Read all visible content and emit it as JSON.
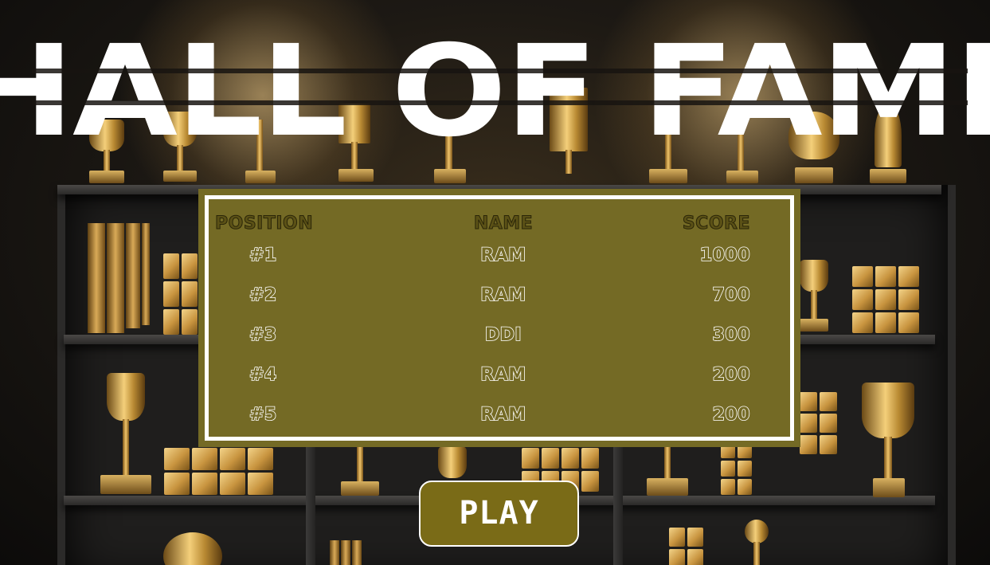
{
  "title": "HALL OF FAME",
  "leaderboard": {
    "headers": {
      "position": "POSITION",
      "name": "NAME",
      "score": "SCORE"
    },
    "rows": [
      {
        "position": "#1",
        "name": "RAM",
        "score": "1000"
      },
      {
        "position": "#2",
        "name": "RAM",
        "score": "700"
      },
      {
        "position": "#3",
        "name": "DDI",
        "score": "300"
      },
      {
        "position": "#4",
        "name": "RAM",
        "score": "200"
      },
      {
        "position": "#5",
        "name": "RAM",
        "score": "200"
      }
    ]
  },
  "play_button": {
    "label": "PLAY"
  },
  "colors": {
    "panel": "#746a25",
    "panel_border": "#ffffff",
    "button": "#7a6b17",
    "title": "#ffffff"
  },
  "background": {
    "description_icon": "trophy-shelf-background"
  }
}
